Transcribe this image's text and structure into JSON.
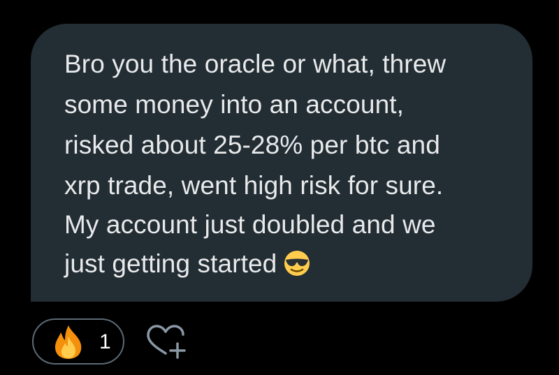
{
  "message": {
    "lines": [
      "Bro you the oracle or what, threw",
      "some money into an account,",
      "risked about 25-28% per btc and",
      "xrp trade, went high risk for sure.",
      "My account just doubled and we",
      "just getting started"
    ],
    "emoji_icon": "sunglasses-face-icon"
  },
  "reaction": {
    "icon": "fire-icon",
    "count": "1"
  },
  "add_reaction": {
    "icon": "heart-plus-icon"
  },
  "colors": {
    "background": "#000000",
    "bubble": "#232d34",
    "text": "#e8eaeb",
    "pill_border": "#5b6b76"
  }
}
